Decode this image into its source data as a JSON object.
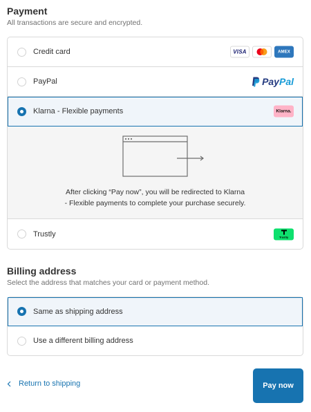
{
  "payment": {
    "title": "Payment",
    "subtitle": "All transactions are secure and encrypted.",
    "options": [
      {
        "label": "Credit card",
        "selected": false
      },
      {
        "label": "PayPal",
        "selected": false
      },
      {
        "label": "Klarna - Flexible payments",
        "selected": true
      },
      {
        "label": "Trustly",
        "selected": false
      }
    ],
    "card_logos": {
      "visa": "VISA",
      "amex": "AMERICAN EXPRESS"
    },
    "paypal_logo": {
      "pay": "Pay",
      "pal": "Pal"
    },
    "klarna_logo": "Klarna.",
    "trustly_logo": "Trustly",
    "redirect_message_line1": "After clicking “Pay now”, you will be redirected to Klarna",
    "redirect_message_line2": "- Flexible payments to complete your purchase securely."
  },
  "billing": {
    "title": "Billing address",
    "subtitle": "Select the address that matches your card or payment method.",
    "options": [
      {
        "label": "Same as shipping address",
        "selected": true
      },
      {
        "label": "Use a different billing address",
        "selected": false
      }
    ]
  },
  "footer": {
    "back_label": "Return to shipping",
    "pay_label": "Pay now"
  },
  "colors": {
    "accent": "#1773b0",
    "selected_bg": "#f0f5fa",
    "border": "#d9d9d9",
    "klarna_pink": "#ffb3c7",
    "trustly_green": "#0ee06e"
  }
}
